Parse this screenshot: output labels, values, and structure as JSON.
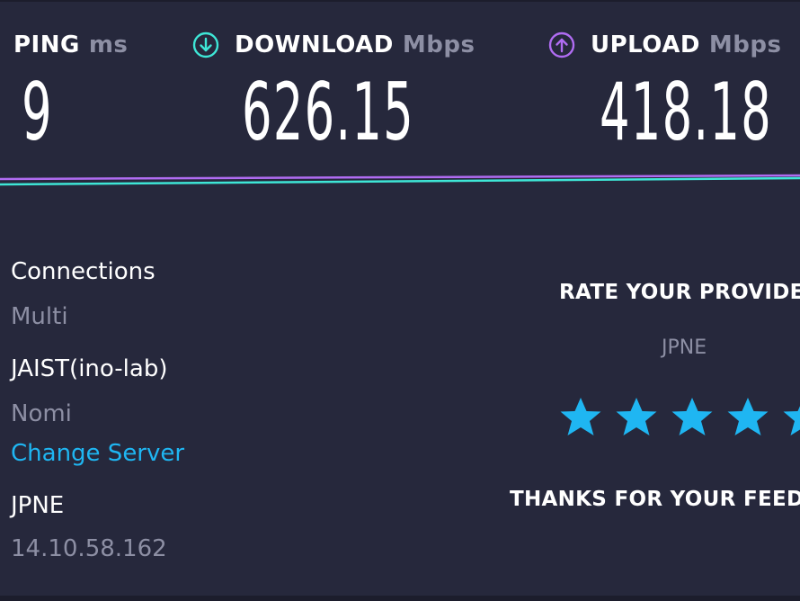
{
  "metrics": {
    "ping": {
      "label": "PING",
      "unit": "ms",
      "value": "9"
    },
    "download": {
      "label": "DOWNLOAD",
      "unit": "Mbps",
      "value": "626.15",
      "icon": "download-arrow-icon",
      "color": "#3ee6d6"
    },
    "upload": {
      "label": "UPLOAD",
      "unit": "Mbps",
      "value": "418.18",
      "icon": "upload-arrow-icon",
      "color": "#b06cf2"
    }
  },
  "server": {
    "connections_title": "Connections",
    "connections_value": "Multi",
    "name": "JAIST(ino-lab)",
    "location": "Nomi",
    "change_server_label": "Change Server",
    "isp_name": "JPNE",
    "isp_ip": "14.10.58.162"
  },
  "rating": {
    "title": "RATE YOUR PROVIDER",
    "provider": "JPNE",
    "stars_selected": 5,
    "stars_total": 5,
    "star_color": "#1fb6f2",
    "thanks": "THANKS FOR YOUR FEEDBACK"
  },
  "colors": {
    "background": "#26283c",
    "muted_text": "#8d8fa4",
    "link": "#1fb6f2",
    "trace_download": "#3ee6d6",
    "trace_upload": "#b06cf2"
  }
}
